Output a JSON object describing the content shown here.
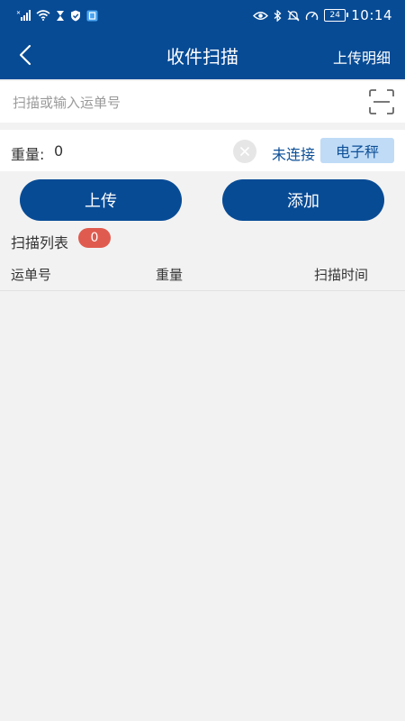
{
  "status_bar": {
    "time": "10:14",
    "battery": "24",
    "icons": [
      "signal-icon",
      "wifi-icon",
      "hourglass-icon",
      "shield-icon",
      "app-badge-icon",
      "eye-icon",
      "bluetooth-icon",
      "mute-icon",
      "speed-icon",
      "battery-icon"
    ]
  },
  "header": {
    "title": "收件扫描",
    "action": "上传明细",
    "back_icon": "back-chevron-icon"
  },
  "scan": {
    "placeholder": "扫描或输入运单号",
    "icon": "scan-icon"
  },
  "weight": {
    "label": "重量:",
    "value": "0",
    "connection_status": "未连接",
    "scale_button": "电子秤"
  },
  "buttons": {
    "upload": "上传",
    "add": "添加"
  },
  "list": {
    "title": "扫描列表",
    "count": "0",
    "columns": [
      "运单号",
      "重量",
      "扫描时间"
    ]
  },
  "colors": {
    "primary": "#074b95",
    "accent_light": "#bfdbf6",
    "badge": "#e05b4f",
    "background": "#f2f2f2"
  }
}
